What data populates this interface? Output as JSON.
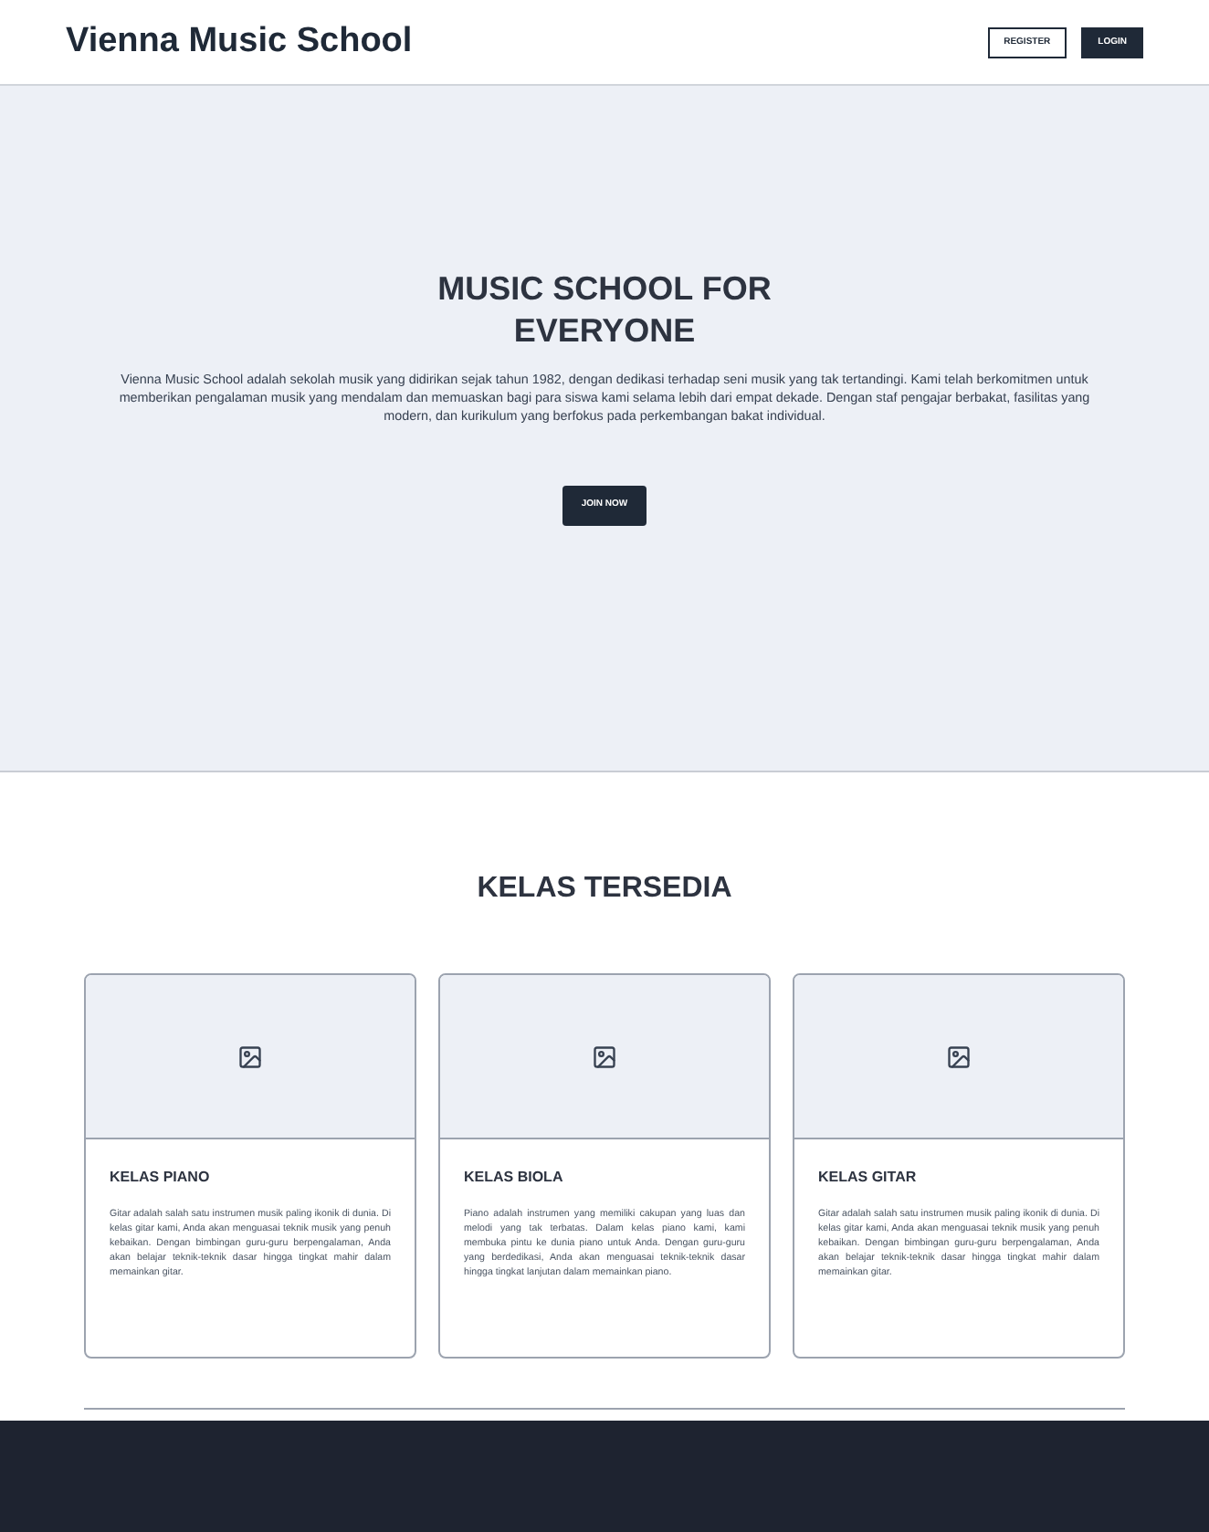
{
  "header": {
    "brand": "Vienna Music School",
    "buttons": [
      {
        "label": "REGISTER",
        "kind": "outline"
      },
      {
        "label": "LOGIN",
        "kind": "solid"
      }
    ]
  },
  "hero": {
    "title": "MUSIC SCHOOL FOR EVERYONE",
    "text": "Vienna Music School adalah sekolah musik yang didirikan sejak tahun 1982, dengan dedikasi terhadap seni musik yang tak tertandingi. Kami telah berkomitmen untuk memberikan pengalaman musik yang mendalam dan memuaskan bagi para siswa kami selama lebih dari empat dekade. Dengan staf pengajar berbakat, fasilitas yang modern, dan kurikulum yang berfokus pada perkembangan bakat individual.",
    "button": "JOIN NOW"
  },
  "classes": {
    "title": "KELAS TERSEDIA",
    "cards": [
      {
        "title": "KELAS PIANO",
        "text": "Gitar adalah salah satu instrumen musik paling ikonik di dunia. Di kelas gitar kami, Anda akan menguasai teknik musik yang penuh kebaikan. Dengan bimbingan guru-guru berpengalaman, Anda akan belajar teknik-teknik dasar hingga tingkat mahir dalam memainkan gitar."
      },
      {
        "title": "KELAS BIOLA",
        "text": "Piano adalah instrumen yang memiliki cakupan yang luas dan melodi yang tak terbatas. Dalam kelas piano kami, kami membuka pintu ke dunia piano untuk Anda. Dengan guru-guru yang berdedikasi, Anda akan menguasai teknik-teknik dasar hingga tingkat lanjutan dalam memainkan piano."
      },
      {
        "title": "KELAS GITAR",
        "text": "Gitar adalah salah satu instrumen musik paling ikonik di dunia. Di kelas gitar kami, Anda akan menguasai teknik musik yang penuh kebaikan. Dengan bimbingan guru-guru berpengalaman, Anda akan belajar teknik-teknik dasar hingga tingkat mahir dalam memainkan gitar."
      }
    ]
  }
}
